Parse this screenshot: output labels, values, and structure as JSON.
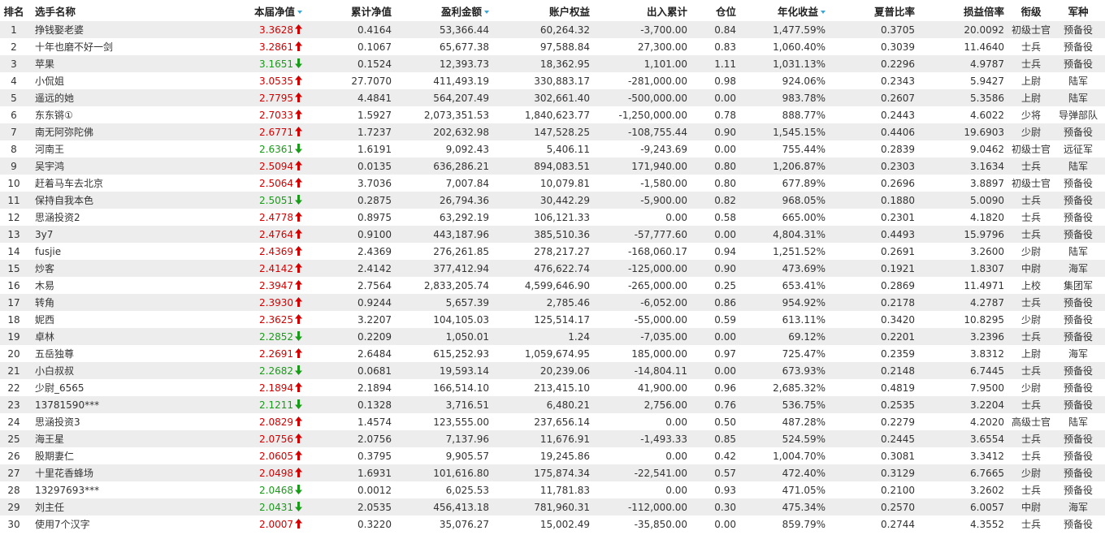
{
  "colors": {
    "up": "#d40000",
    "down": "#1a9b1a",
    "sort_icon": "#3aa6d6",
    "row_stripe": "#ededed"
  },
  "headers": {
    "rank": "排名",
    "name": "选手名称",
    "nav": "本届净值",
    "cum_nav": "累计净值",
    "pnl": "盈利金额",
    "equity": "账户权益",
    "flow": "出入累计",
    "position": "仓位",
    "annual": "年化收益",
    "sharpe": "夏普比率",
    "pl_ratio": "损益倍率",
    "title": "衔级",
    "branch": "军种"
  },
  "rows": [
    {
      "rank": "1",
      "name": "挣钱娶老婆",
      "nav": "3.3628",
      "dir": "up",
      "cum_nav": "0.4164",
      "pnl": "53,366.44",
      "equity": "60,264.32",
      "flow": "-3,700.00",
      "position": "0.84",
      "annual": "1,477.59%",
      "sharpe": "0.3705",
      "pl_ratio": "20.0092",
      "title": "初级士官",
      "branch": "预备役"
    },
    {
      "rank": "2",
      "name": "十年也磨不好一剑",
      "nav": "3.2861",
      "dir": "up",
      "cum_nav": "0.1067",
      "pnl": "65,677.38",
      "equity": "97,588.84",
      "flow": "27,300.00",
      "position": "0.83",
      "annual": "1,060.40%",
      "sharpe": "0.3039",
      "pl_ratio": "11.4640",
      "title": "士兵",
      "branch": "预备役"
    },
    {
      "rank": "3",
      "name": "苹果",
      "nav": "3.1651",
      "dir": "down",
      "cum_nav": "0.1524",
      "pnl": "12,393.73",
      "equity": "18,362.95",
      "flow": "1,101.00",
      "position": "1.11",
      "annual": "1,031.13%",
      "sharpe": "0.2296",
      "pl_ratio": "4.9787",
      "title": "士兵",
      "branch": "预备役"
    },
    {
      "rank": "4",
      "name": "小侃姐",
      "nav": "3.0535",
      "dir": "up",
      "cum_nav": "27.7070",
      "pnl": "411,493.19",
      "equity": "330,883.17",
      "flow": "-281,000.00",
      "position": "0.98",
      "annual": "924.06%",
      "sharpe": "0.2343",
      "pl_ratio": "5.9427",
      "title": "上尉",
      "branch": "陆军"
    },
    {
      "rank": "5",
      "name": "遥远的她",
      "nav": "2.7795",
      "dir": "up",
      "cum_nav": "4.4841",
      "pnl": "564,207.49",
      "equity": "302,661.40",
      "flow": "-500,000.00",
      "position": "0.00",
      "annual": "983.78%",
      "sharpe": "0.2607",
      "pl_ratio": "5.3586",
      "title": "上尉",
      "branch": "陆军"
    },
    {
      "rank": "6",
      "name": "东东锵①",
      "nav": "2.7033",
      "dir": "up",
      "cum_nav": "1.5927",
      "pnl": "2,073,351.53",
      "equity": "1,840,623.77",
      "flow": "-1,250,000.00",
      "position": "0.78",
      "annual": "888.77%",
      "sharpe": "0.2443",
      "pl_ratio": "4.6022",
      "title": "少将",
      "branch": "导弹部队"
    },
    {
      "rank": "7",
      "name": "南无阿弥陀佛",
      "nav": "2.6771",
      "dir": "up",
      "cum_nav": "1.7237",
      "pnl": "202,632.98",
      "equity": "147,528.25",
      "flow": "-108,755.44",
      "position": "0.90",
      "annual": "1,545.15%",
      "sharpe": "0.4406",
      "pl_ratio": "19.6903",
      "title": "少尉",
      "branch": "预备役"
    },
    {
      "rank": "8",
      "name": "河南王",
      "nav": "2.6361",
      "dir": "down",
      "cum_nav": "1.6191",
      "pnl": "9,092.43",
      "equity": "5,406.11",
      "flow": "-9,243.69",
      "position": "0.00",
      "annual": "755.44%",
      "sharpe": "0.2839",
      "pl_ratio": "9.0462",
      "title": "初级士官",
      "branch": "远征军"
    },
    {
      "rank": "9",
      "name": "吴宇鸿",
      "nav": "2.5094",
      "dir": "up",
      "cum_nav": "0.0135",
      "pnl": "636,286.21",
      "equity": "894,083.51",
      "flow": "171,940.00",
      "position": "0.80",
      "annual": "1,206.87%",
      "sharpe": "0.2303",
      "pl_ratio": "3.1634",
      "title": "士兵",
      "branch": "陆军"
    },
    {
      "rank": "10",
      "name": "赶着马车去北京",
      "nav": "2.5064",
      "dir": "up",
      "cum_nav": "3.7036",
      "pnl": "7,007.84",
      "equity": "10,079.81",
      "flow": "-1,580.00",
      "position": "0.80",
      "annual": "677.89%",
      "sharpe": "0.2696",
      "pl_ratio": "3.8897",
      "title": "初级士官",
      "branch": "预备役"
    },
    {
      "rank": "11",
      "name": "保持自我本色",
      "nav": "2.5051",
      "dir": "down",
      "cum_nav": "0.2875",
      "pnl": "26,794.36",
      "equity": "30,442.29",
      "flow": "-5,900.00",
      "position": "0.82",
      "annual": "968.05%",
      "sharpe": "0.1880",
      "pl_ratio": "5.0090",
      "title": "士兵",
      "branch": "预备役"
    },
    {
      "rank": "12",
      "name": "思涵投资2",
      "nav": "2.4778",
      "dir": "up",
      "cum_nav": "0.8975",
      "pnl": "63,292.19",
      "equity": "106,121.33",
      "flow": "0.00",
      "position": "0.58",
      "annual": "665.00%",
      "sharpe": "0.2301",
      "pl_ratio": "4.1820",
      "title": "士兵",
      "branch": "预备役"
    },
    {
      "rank": "13",
      "name": "3y7",
      "nav": "2.4764",
      "dir": "up",
      "cum_nav": "0.9100",
      "pnl": "443,187.96",
      "equity": "385,510.36",
      "flow": "-57,777.60",
      "position": "0.00",
      "annual": "4,804.31%",
      "sharpe": "0.4493",
      "pl_ratio": "15.9796",
      "title": "士兵",
      "branch": "预备役"
    },
    {
      "rank": "14",
      "name": "fusjie",
      "nav": "2.4369",
      "dir": "up",
      "cum_nav": "2.4369",
      "pnl": "276,261.85",
      "equity": "278,217.27",
      "flow": "-168,060.17",
      "position": "0.94",
      "annual": "1,251.52%",
      "sharpe": "0.2691",
      "pl_ratio": "3.2600",
      "title": "少尉",
      "branch": "陆军"
    },
    {
      "rank": "15",
      "name": "炒客",
      "nav": "2.4142",
      "dir": "up",
      "cum_nav": "2.4142",
      "pnl": "377,412.94",
      "equity": "476,622.74",
      "flow": "-125,000.00",
      "position": "0.90",
      "annual": "473.69%",
      "sharpe": "0.1921",
      "pl_ratio": "1.8307",
      "title": "中尉",
      "branch": "海军"
    },
    {
      "rank": "16",
      "name": "木易",
      "nav": "2.3947",
      "dir": "up",
      "cum_nav": "2.7564",
      "pnl": "2,833,205.74",
      "equity": "4,599,646.90",
      "flow": "-265,000.00",
      "position": "0.25",
      "annual": "653.41%",
      "sharpe": "0.2869",
      "pl_ratio": "11.4971",
      "title": "上校",
      "branch": "集团军"
    },
    {
      "rank": "17",
      "name": "转角",
      "nav": "2.3930",
      "dir": "up",
      "cum_nav": "0.9244",
      "pnl": "5,657.39",
      "equity": "2,785.46",
      "flow": "-6,052.00",
      "position": "0.86",
      "annual": "954.92%",
      "sharpe": "0.2178",
      "pl_ratio": "4.2787",
      "title": "士兵",
      "branch": "预备役"
    },
    {
      "rank": "18",
      "name": "妮西",
      "nav": "2.3625",
      "dir": "up",
      "cum_nav": "3.2207",
      "pnl": "104,105.03",
      "equity": "125,514.17",
      "flow": "-55,000.00",
      "position": "0.59",
      "annual": "613.11%",
      "sharpe": "0.3420",
      "pl_ratio": "10.8295",
      "title": "少尉",
      "branch": "预备役"
    },
    {
      "rank": "19",
      "name": "卓林",
      "nav": "2.2852",
      "dir": "down",
      "cum_nav": "0.2209",
      "pnl": "1,050.01",
      "equity": "1.24",
      "flow": "-7,035.00",
      "position": "0.00",
      "annual": "69.12%",
      "sharpe": "0.2201",
      "pl_ratio": "3.2396",
      "title": "士兵",
      "branch": "预备役"
    },
    {
      "rank": "20",
      "name": "五岳独尊",
      "nav": "2.2691",
      "dir": "up",
      "cum_nav": "2.6484",
      "pnl": "615,252.93",
      "equity": "1,059,674.95",
      "flow": "185,000.00",
      "position": "0.97",
      "annual": "725.47%",
      "sharpe": "0.2359",
      "pl_ratio": "3.8312",
      "title": "上尉",
      "branch": "海军"
    },
    {
      "rank": "21",
      "name": "小白叔叔",
      "nav": "2.2682",
      "dir": "down",
      "cum_nav": "0.0681",
      "pnl": "19,593.14",
      "equity": "20,239.06",
      "flow": "-14,804.11",
      "position": "0.00",
      "annual": "673.93%",
      "sharpe": "0.2148",
      "pl_ratio": "6.7445",
      "title": "士兵",
      "branch": "预备役"
    },
    {
      "rank": "22",
      "name": "少尉_6565",
      "nav": "2.1894",
      "dir": "up",
      "cum_nav": "2.1894",
      "pnl": "166,514.10",
      "equity": "213,415.10",
      "flow": "41,900.00",
      "position": "0.96",
      "annual": "2,685.32%",
      "sharpe": "0.4819",
      "pl_ratio": "7.9500",
      "title": "少尉",
      "branch": "预备役"
    },
    {
      "rank": "23",
      "name": "13781590***",
      "nav": "2.1211",
      "dir": "down",
      "cum_nav": "0.1328",
      "pnl": "3,716.51",
      "equity": "6,480.21",
      "flow": "2,756.00",
      "position": "0.76",
      "annual": "536.75%",
      "sharpe": "0.2535",
      "pl_ratio": "3.2204",
      "title": "士兵",
      "branch": "预备役"
    },
    {
      "rank": "24",
      "name": "思涵投资3",
      "nav": "2.0829",
      "dir": "up",
      "cum_nav": "1.4574",
      "pnl": "123,555.00",
      "equity": "237,656.14",
      "flow": "0.00",
      "position": "0.50",
      "annual": "487.28%",
      "sharpe": "0.2279",
      "pl_ratio": "4.2020",
      "title": "高级士官",
      "branch": "陆军"
    },
    {
      "rank": "25",
      "name": "海王星",
      "nav": "2.0756",
      "dir": "up",
      "cum_nav": "2.0756",
      "pnl": "7,137.96",
      "equity": "11,676.91",
      "flow": "-1,493.33",
      "position": "0.85",
      "annual": "524.59%",
      "sharpe": "0.2445",
      "pl_ratio": "3.6554",
      "title": "士兵",
      "branch": "预备役"
    },
    {
      "rank": "26",
      "name": "股期妻仁",
      "nav": "2.0605",
      "dir": "up",
      "cum_nav": "0.3795",
      "pnl": "9,905.57",
      "equity": "19,245.86",
      "flow": "0.00",
      "position": "0.42",
      "annual": "1,004.70%",
      "sharpe": "0.3081",
      "pl_ratio": "3.3412",
      "title": "士兵",
      "branch": "预备役"
    },
    {
      "rank": "27",
      "name": "十里花香蜂场",
      "nav": "2.0498",
      "dir": "up",
      "cum_nav": "1.6931",
      "pnl": "101,616.80",
      "equity": "175,874.34",
      "flow": "-22,541.00",
      "position": "0.57",
      "annual": "472.40%",
      "sharpe": "0.3129",
      "pl_ratio": "6.7665",
      "title": "少尉",
      "branch": "预备役"
    },
    {
      "rank": "28",
      "name": "13297693***",
      "nav": "2.0468",
      "dir": "down",
      "cum_nav": "0.0012",
      "pnl": "6,025.53",
      "equity": "11,781.83",
      "flow": "0.00",
      "position": "0.93",
      "annual": "471.05%",
      "sharpe": "0.2100",
      "pl_ratio": "3.2602",
      "title": "士兵",
      "branch": "预备役"
    },
    {
      "rank": "29",
      "name": "刘主任",
      "nav": "2.0431",
      "dir": "down",
      "cum_nav": "2.0535",
      "pnl": "456,413.18",
      "equity": "781,960.31",
      "flow": "-112,000.00",
      "position": "0.30",
      "annual": "475.34%",
      "sharpe": "0.2570",
      "pl_ratio": "6.0057",
      "title": "中尉",
      "branch": "海军"
    },
    {
      "rank": "30",
      "name": "使用7个汉字",
      "nav": "2.0007",
      "dir": "up",
      "cum_nav": "0.3220",
      "pnl": "35,076.27",
      "equity": "15,002.49",
      "flow": "-35,850.00",
      "position": "0.00",
      "annual": "859.79%",
      "sharpe": "0.2744",
      "pl_ratio": "4.3552",
      "title": "士兵",
      "branch": "预备役"
    }
  ]
}
